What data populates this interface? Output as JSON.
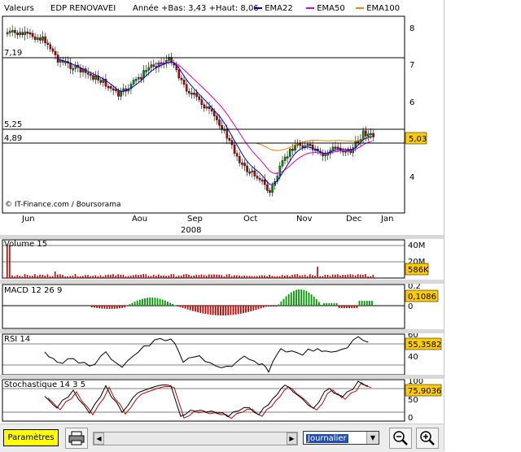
{
  "header": {
    "valeurs_label": "Valeurs",
    "stock_name": "EDP RENOVAVEI",
    "annee_text": "Année +Bas: 3,43 +Haut: 8,06",
    "ema22_label": "EMA22",
    "ema50_label": "EMA50",
    "ema100_label": "EMA100"
  },
  "colors": {
    "ema22": "#0000cc",
    "ema50": "#dd00dd",
    "ema100": "#ff8000",
    "up_candle": "#009900",
    "down_candle": "#cc0000",
    "price_badge": "#ffcc00"
  },
  "main_chart": {
    "price_ticks": [
      "8",
      "7",
      "6",
      "5",
      "4"
    ],
    "levels": [
      "7,19",
      "5,25",
      "4,89"
    ],
    "current_price": "5,03",
    "copyright": "© IT-Finance.com / Boursorama",
    "months": [
      "Jun",
      "Aou",
      "Sep",
      "Oct",
      "Nov",
      "Dec",
      "Jan"
    ],
    "year": "2008"
  },
  "volume": {
    "title": "Volume 15",
    "ticks": [
      "40M",
      "20M"
    ],
    "current": "586K"
  },
  "macd": {
    "title": "MACD 12 26 9",
    "ticks": [
      "0.2",
      "0"
    ],
    "current": "0,1086"
  },
  "rsi": {
    "title": "RSI 14",
    "ticks": [
      "60",
      "40"
    ],
    "current": "55,3582"
  },
  "stoch": {
    "title": "Stochastique 14 3 5",
    "ticks": [
      "100",
      "50",
      "0"
    ],
    "current": "75,9036"
  },
  "toolbar": {
    "params_label": "Paramètres",
    "period_value": "Journalier"
  }
}
